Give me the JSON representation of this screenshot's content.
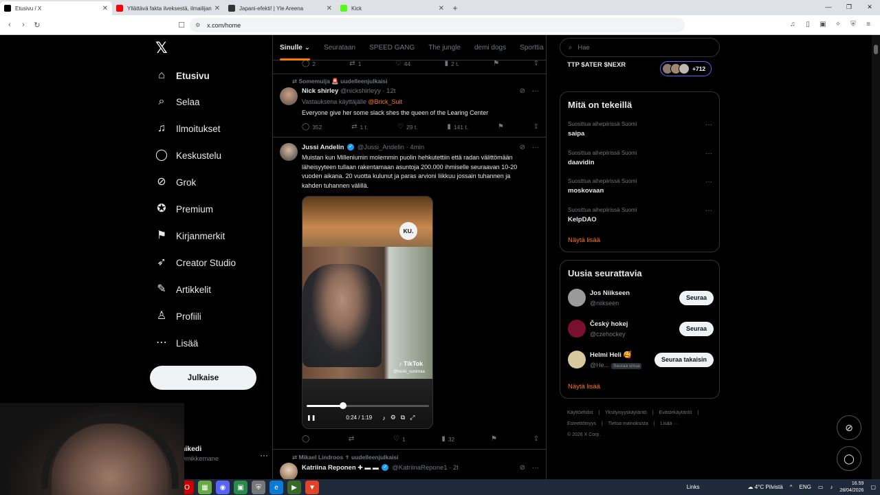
{
  "browser": {
    "tabs": [
      {
        "title": "Etusivu / X",
        "favicon_color": "#000000",
        "active": true
      },
      {
        "title": "Yllättävä fakta ilveksestä, ilmailijan ratkaisut",
        "favicon_color": "#ff0000",
        "active": false
      },
      {
        "title": "Japani-efekti! | Yle Areena",
        "favicon_color": "#333333",
        "active": false
      },
      {
        "title": "Kick",
        "favicon_color": "#53fc18",
        "active": false
      }
    ],
    "url": "x.com/home"
  },
  "nav": {
    "items": [
      {
        "label": "Etusivu",
        "icon": "home-icon",
        "glyph": "⌂"
      },
      {
        "label": "Selaa",
        "icon": "search-icon",
        "glyph": "⌕"
      },
      {
        "label": "Ilmoitukset",
        "icon": "bell-icon",
        "glyph": "♫"
      },
      {
        "label": "Keskustelu",
        "icon": "chat-icon",
        "glyph": "◯"
      },
      {
        "label": "Grok",
        "icon": "grok-icon",
        "glyph": "⊘"
      },
      {
        "label": "Premium",
        "icon": "premium-icon",
        "glyph": "✪"
      },
      {
        "label": "Kirjanmerkit",
        "icon": "bookmark-icon",
        "glyph": "⚑"
      },
      {
        "label": "Creator Studio",
        "icon": "rocket-icon",
        "glyph": "➶"
      },
      {
        "label": "Artikkelit",
        "icon": "article-icon",
        "glyph": "✎"
      },
      {
        "label": "Profiili",
        "icon": "profile-icon",
        "glyph": "♙"
      },
      {
        "label": "Lisää",
        "icon": "more-icon",
        "glyph": "⋯"
      }
    ],
    "post_label": "Julkaise"
  },
  "profile": {
    "name": "mikedi",
    "handle": "@mikkemane"
  },
  "feed": {
    "tabs": [
      "Sinulle",
      "Seurataan",
      "SPEED GANG",
      "The jungle",
      "demi dogs",
      "Sporttia"
    ],
    "top_actions": {
      "replies": "2",
      "reposts": "1",
      "likes": "44",
      "views": "2 t."
    },
    "tweet1": {
      "reposted_by": "Somemuija 🚨 uudelleenjulkaisi",
      "name": "Nick shirley",
      "handle": "@nickshirleyy · 12t",
      "reply_prefix": "Vastauksena käyttäjälle",
      "reply_to": "@Brick_Suit",
      "text": "Everyone give her some slack shes the queen of the Learing Center",
      "replies": "352",
      "reposts": "1 t.",
      "likes": "29 t.",
      "views": "141 t."
    },
    "tweet2": {
      "name": "Jussi Andelin",
      "handle": "@Jussi_Andelin · 4min",
      "text": "Muistan kun Milleniumin molemmin puolin hehkutettiin että radan välittömään läheisyyteen tullaan rakentamaan asuntoja 200.000 ihmiselle seuraavan 10-20 vuoden aikana. 20 vuotta kulunut ja paras arvioni liikkuu jossain tuhannen ja kahden tuhannen välillä.",
      "video": {
        "badge": "KU.",
        "tiktok": "TikTok",
        "tiktok_handle": "@keski_uusimaa",
        "time": "0:24 / 1:19",
        "progress": 0.3
      },
      "replies": "",
      "reposts": "",
      "likes": "1",
      "views": "32"
    },
    "tweet3": {
      "reposted_by": "Mikael Lindroos ✝ uudelleenjulkaisi",
      "name": "Katriina Reponen",
      "handle": "@KatriinaRepone1 · 2t"
    }
  },
  "right": {
    "search_placeholder": "Hae",
    "ttp": {
      "text": "TTP $ATER $NEXR",
      "count": "+712"
    },
    "trends_title": "Mitä on tekeillä",
    "trends": [
      {
        "meta": "Suosittua aihepiirissä Suomi",
        "topic": "saipa"
      },
      {
        "meta": "Suosittua aihepiirissä Suomi",
        "topic": "daavidin"
      },
      {
        "meta": "Suosittua aihepiirissä Suomi",
        "topic": "moskovaan"
      },
      {
        "meta": "Suosittua aihepiirissä Suomi",
        "topic": "KelpDAO"
      }
    ],
    "show_more": "Näytä lisää",
    "who_title": "Uusia seurattavia",
    "who": [
      {
        "name": "Jos Niikseen",
        "handle": "@niikseen",
        "button": "Seuraa",
        "follows_you": ""
      },
      {
        "name": "Český hokej",
        "handle": "@czehockey",
        "button": "Seuraa",
        "follows_you": ""
      },
      {
        "name": "Helmi Heli 🥰",
        "handle": "@He...",
        "button": "Seuraa takaisin",
        "follows_you": "Seuraa sinua"
      }
    ],
    "footer": [
      "Käyttöehdot",
      "Yksityisyyskäytäntö",
      "Evästekäytäntö",
      "Esteettömyys",
      "Tietoa mainoksista",
      "Lisää ···",
      "© 2026 X Corp."
    ]
  },
  "taskbar": {
    "links": "Links",
    "weather": "4°C Pilvistä",
    "lang": "ENG",
    "time": "16.59",
    "date": "28/04/2026"
  }
}
